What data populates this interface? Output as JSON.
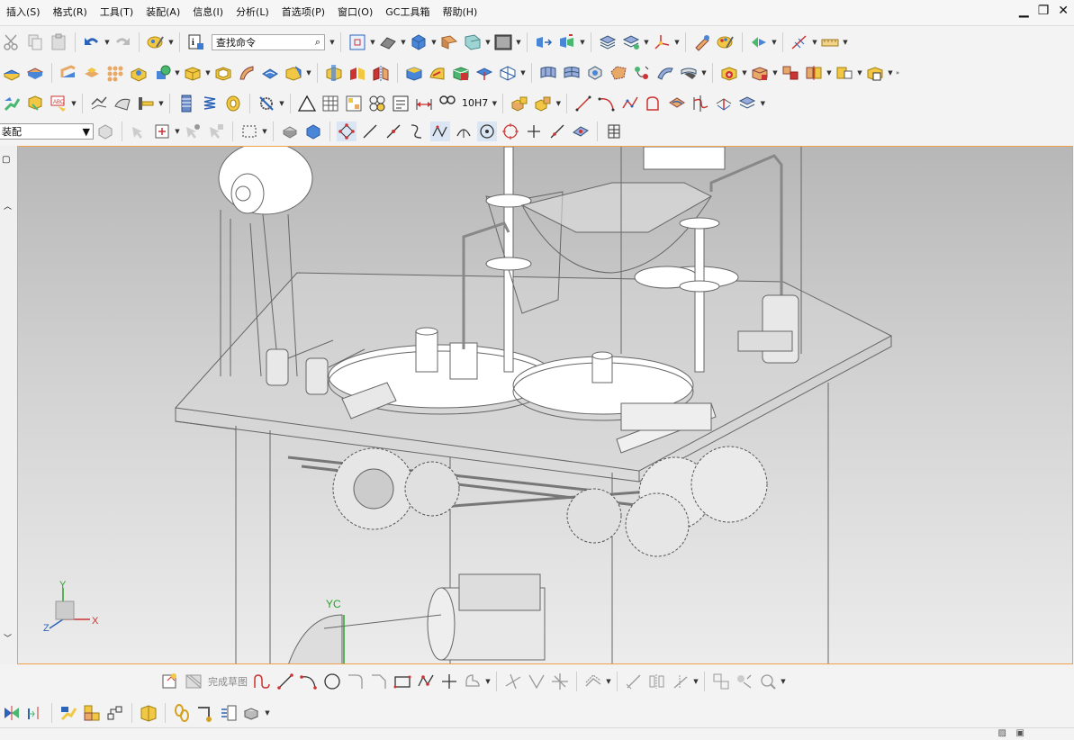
{
  "menu": {
    "items": [
      "插入(S)",
      "格式(R)",
      "工具(T)",
      "装配(A)",
      "信息(I)",
      "分析(L)",
      "首选项(P)",
      "窗口(O)",
      "GC工具箱",
      "帮助(H)"
    ]
  },
  "toolbar": {
    "search_placeholder": "查找命令",
    "filter_value": "装配",
    "fit_label": "10H7"
  },
  "sketch_toolbar": {
    "finish_label": "完成草图"
  },
  "triad": {
    "y": "Y",
    "x": "X",
    "z": "Z"
  },
  "wcs": {
    "yc": "YC"
  },
  "colors": {
    "accent_border": "#f0a04b",
    "viewport_top": "#b7b7b7",
    "viewport_bottom": "#ececec"
  }
}
